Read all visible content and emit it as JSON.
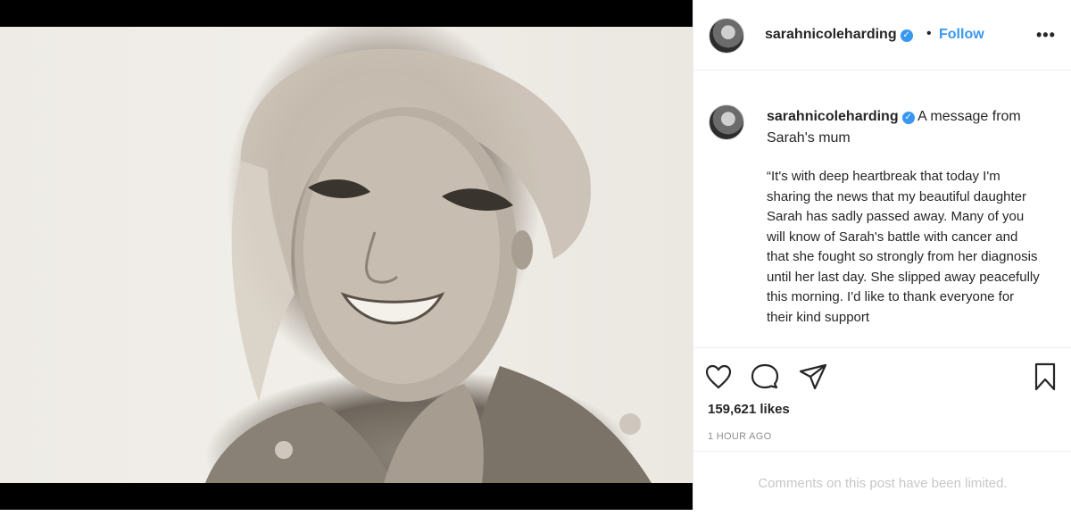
{
  "post": {
    "username": "sarahnicoleharding",
    "verified_icon": "verified-badge-icon",
    "dot_separator": "•",
    "follow_label": "Follow",
    "more_label": "•••",
    "caption": {
      "author": "sarahnicoleharding",
      "title": "A message from Sarah's mum",
      "body": "“It's with deep heartbreak that today I'm sharing the news that my beautiful daughter Sarah has sadly passed away. Many of you will know of Sarah's battle with cancer and that she fought so strongly from her diagnosis until her last day. She slipped away peacefully this morning. I'd like to thank everyone for their kind support"
    },
    "likes": "159,621 likes",
    "time": "1 HOUR AGO",
    "comments_limited": "Comments on this post have been limited.",
    "colors": {
      "accent": "#3897f0",
      "text": "#262626",
      "muted": "#8e8e8e",
      "border": "#efefef"
    }
  }
}
